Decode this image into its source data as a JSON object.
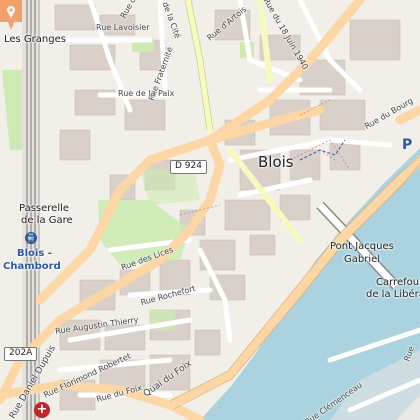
{
  "place": {
    "city_label": "Blois",
    "district_label": "Les Granges",
    "station_name_line1": "Blois -",
    "station_name_line2": "Chambord",
    "footbridge_line1": "Passerelle",
    "footbridge_line2": "de la Gare",
    "bridge_line1": "Pont Jacques",
    "bridge_line2": "Gabriel",
    "crossroad_line1": "Carrefour",
    "crossroad_line2": "de la Libérati"
  },
  "roads": {
    "shield_d924": "D 924",
    "shield_d202a": "202A",
    "shield_parking": "P"
  },
  "streets": {
    "lavoisier": "Rue Lavoisier",
    "artois": "Rue d'Artois",
    "juin": "Rue du 18 Juin 1940",
    "fraternite": "Rue Fraternité",
    "paix": "Rue de la Paix",
    "lices": "Rue des Lices",
    "rochefort": "Rue Rochefort",
    "thierry": "Rue Augustin Thierry",
    "robertet": "Rue Florimond Robertet",
    "foix_rue": "Rue du Foix",
    "foix_quai": "Quai du Foix",
    "dupuis": "Rue Daniel Dupuis",
    "clemenceau": "Rue Clémenceau",
    "bourg": "Rue du Bourg",
    "pre": "Rue",
    "desse": "Rue des",
    "jardins": "Rue de la Cité"
  },
  "icons": {
    "marker": "location-pin-icon",
    "pharmacy": "pharmacy-cross-icon",
    "railway": "railway-station-icon",
    "parking": "parking-icon"
  },
  "colors": {
    "land": "#f2efe9",
    "building": "#d9d0c9",
    "water": "#aad3df",
    "major_road": "#fcd6a4",
    "secondary_road": "#f7fabf",
    "park": "#cdebb0",
    "marker": "#f4a06b"
  }
}
